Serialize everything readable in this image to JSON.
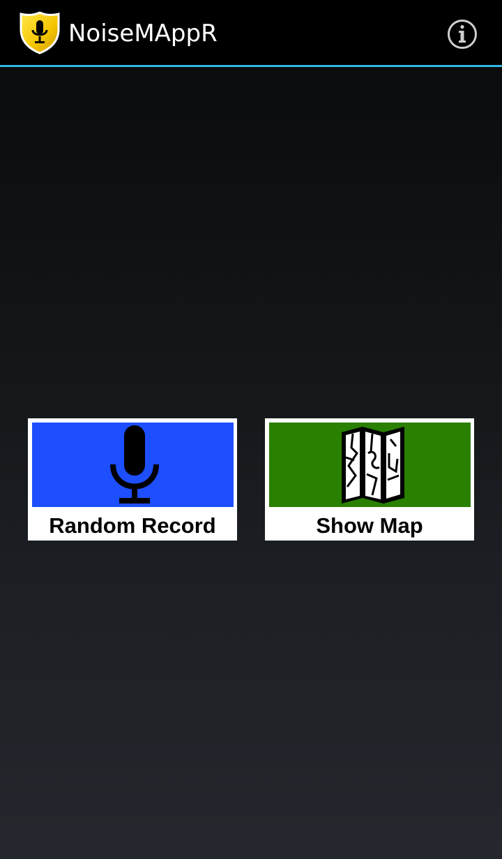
{
  "app": {
    "title": "NoiseMAppR"
  },
  "action_bar": {
    "accent_color": "#33b5e5",
    "logo_icon": "shield-microphone-icon",
    "info_icon": "info-icon"
  },
  "tiles": [
    {
      "label": "Random Record",
      "icon": "microphone-icon",
      "color": "#1d4fff"
    },
    {
      "label": "Show Map",
      "icon": "folded-map-icon",
      "color": "#2a8000"
    }
  ]
}
